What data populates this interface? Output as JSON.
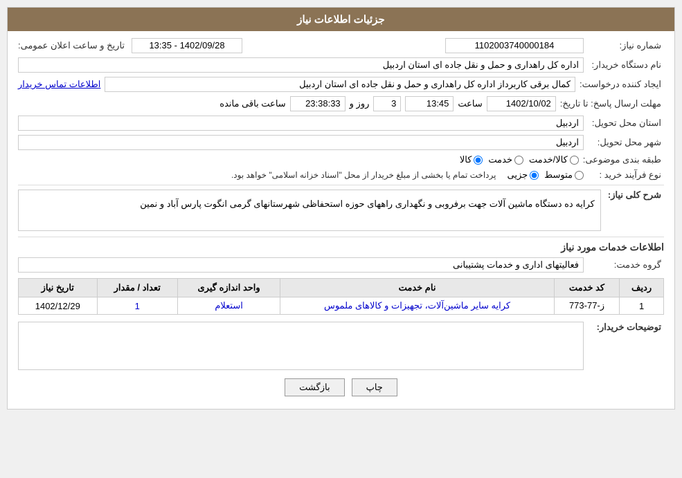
{
  "header": {
    "title": "جزئیات اطلاعات نیاز"
  },
  "fields": {
    "shomara_niaz_label": "شماره نیاز:",
    "shomara_niaz_value": "1102003740000184",
    "nam_dastgah_label": "نام دستگاه خریدار:",
    "nam_dastgah_value": "اداره کل راهداری و حمل و نقل جاده ای استان اردبیل",
    "ijad_konande_label": "ایجاد کننده درخواست:",
    "ijad_konande_value": "کمال برقی کاربرداز اداره کل راهداری و حمل و نقل جاده ای استان اردبیل",
    "ettelaat_tamas_label": "اطلاعات تماس خریدار",
    "mohlat_label": "مهلت ارسال پاسخ: تا تاریخ:",
    "date_value": "1402/10/02",
    "saat_label": "ساعت",
    "saat_value": "13:45",
    "roz_label": "روز و",
    "roz_value": "3",
    "baki_mande_label": "ساعت باقی مانده",
    "baki_mande_value": "23:38:33",
    "tarikh_aalan_label": "تاریخ و ساعت اعلان عمومی:",
    "tarikh_aalan_value": "1402/09/28 - 13:35",
    "ostan_tahvil_label": "استان محل تحویل:",
    "ostan_tahvil_value": "اردبیل",
    "shahr_tahvil_label": "شهر محل تحویل:",
    "shahr_tahvil_value": "اردبیل",
    "tabaqeh_label": "طبقه بندی موضوعی:",
    "tabaqeh_kala": "کالا",
    "tabaqeh_khedmat": "خدمت",
    "tabaqeh_kala_khedmat": "کالا/خدمت",
    "noé_farayand_label": "نوع فرآیند خرید :",
    "noé_jozvi": "جزیی",
    "noé_motavaset": "متوسط",
    "noé_notice": "پرداخت تمام یا بخشی از مبلغ خریدار از محل \"اسناد خزانه اسلامی\" خواهد بود."
  },
  "sharh": {
    "section_title": "شرح کلی نیاز:",
    "content": "کرایه ده دستگاه ماشین آلات جهت برفروبی و نگهداری راههای حوزه استحفاظی شهرستانهای گرمی انگوت پارس آباد و نمین"
  },
  "khadamat": {
    "section_title": "اطلاعات خدمات مورد نیاز",
    "group_label": "گروه خدمت:",
    "group_value": "فعالیتهای اداری و خدمات پشتیبانی",
    "table": {
      "headers": [
        "ردیف",
        "کد خدمت",
        "نام خدمت",
        "واحد اندازه گیری",
        "تعداد / مقدار",
        "تاریخ نیاز"
      ],
      "rows": [
        {
          "radif": "1",
          "kod_khedmat": "ز-77-773",
          "nam_khedmat": "کرایه سایر ماشین‌آلات، تجهیزات و کالاهای ملموس",
          "vahed": "استعلام",
          "tedad": "1",
          "tarikh": "1402/12/29"
        }
      ]
    }
  },
  "toseeh": {
    "label": "توضیحات خریدار:"
  },
  "buttons": {
    "chap": "چاپ",
    "bazgasht": "بازگشت"
  }
}
